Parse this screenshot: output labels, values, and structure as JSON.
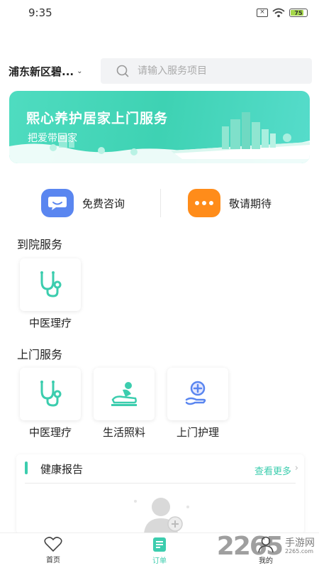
{
  "status_bar": {
    "time": "9:35",
    "battery": "75"
  },
  "header": {
    "location": "浦东新区碧...",
    "search_placeholder": "请输入服务项目"
  },
  "banner": {
    "title": "熙心养护居家上门服务",
    "subtitle": "把爱带回家"
  },
  "quick_actions": [
    {
      "label": "免费咨询",
      "icon": "chat-bubble-icon",
      "color": "#5a86f0"
    },
    {
      "label": "敬请期待",
      "icon": "more-dots-icon",
      "color": "#ff8c1a"
    }
  ],
  "hospital_services": {
    "title": "到院服务",
    "items": [
      {
        "label": "中医理疗",
        "icon": "stethoscope-icon"
      }
    ]
  },
  "home_services": {
    "title": "上门服务",
    "items": [
      {
        "label": "中医理疗",
        "icon": "stethoscope-icon"
      },
      {
        "label": "生活照料",
        "icon": "massage-icon"
      },
      {
        "label": "上门护理",
        "icon": "care-hand-icon"
      }
    ]
  },
  "health_report": {
    "title": "健康报告",
    "more_label": "查看更多"
  },
  "bottom_nav": [
    {
      "label": "首页",
      "icon": "heart-icon"
    },
    {
      "label": "订单",
      "icon": "order-icon",
      "active": true
    },
    {
      "label": "我的",
      "icon": "user-icon"
    }
  ],
  "watermark": {
    "number": "2265",
    "text": "手游网",
    "domain": "2265.com"
  },
  "colors": {
    "accent": "#3ccdae",
    "consult": "#5a86f0",
    "coming": "#ff8c1a"
  }
}
